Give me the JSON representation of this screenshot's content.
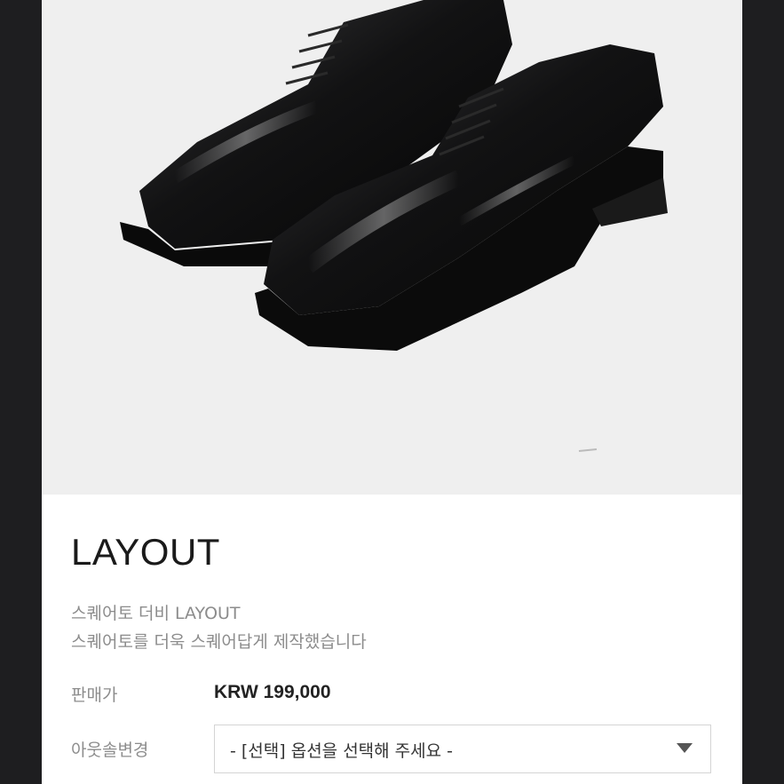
{
  "product": {
    "image_alt": "black square-toe derby shoes",
    "name": "LAYOUT",
    "description_lines": [
      "스퀘어토 더비 LAYOUT",
      "스퀘어토를 더욱 스퀘어답게 제작했습니다"
    ]
  },
  "info": {
    "price_label": "판매가",
    "price_value": "KRW 199,000",
    "option_label": "아웃솔변경",
    "option_selected": "- [선택] 옵션을 선택해 주세요 -",
    "option_icon": "triangle-down-icon"
  },
  "colors": {
    "background": "#1e1e20",
    "hero": "#efefef",
    "text_muted": "#8c8c8c"
  }
}
